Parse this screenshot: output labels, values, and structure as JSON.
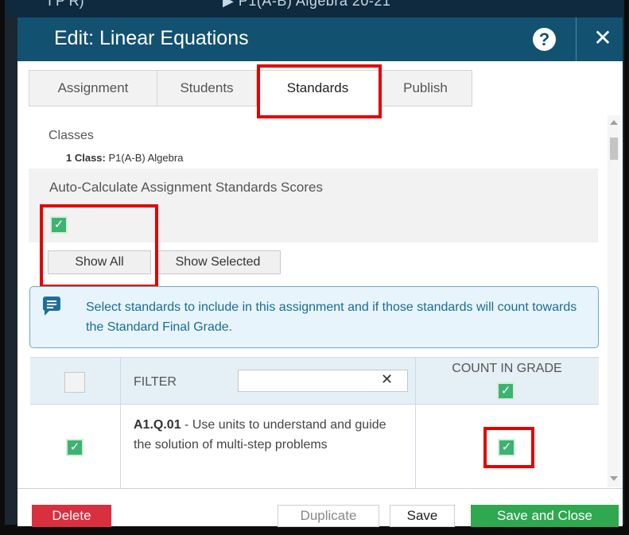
{
  "background": {
    "left_text": "I P R)",
    "center_text": "▶ P1(A-B) Algebra  20-21"
  },
  "header": {
    "title": "Edit: Linear Equations",
    "help_label": "?",
    "close_label": "✕"
  },
  "tabs": [
    {
      "label": "Assignment",
      "active": false
    },
    {
      "label": "Students",
      "active": false
    },
    {
      "label": "Standards",
      "active": true
    },
    {
      "label": "Publish",
      "active": false
    }
  ],
  "classes": {
    "heading": "Classes",
    "count_label": "1 Class:",
    "class_name": "P1(A-B) Algebra"
  },
  "auto_calculate": {
    "label": "Auto-Calculate Assignment Standards Scores",
    "checked": true
  },
  "view_buttons": {
    "show_all": "Show All",
    "show_selected": "Show Selected"
  },
  "info": {
    "message": "Select standards to include in this assignment and if those standards will count towards the Standard Final Grade."
  },
  "table": {
    "filter_label": "FILTER",
    "filter_value": "",
    "filter_clear": "✕",
    "count_in_grade_label": "COUNT IN GRADE",
    "rows": [
      {
        "code": "A1.Q.01",
        "description": " - Use units to understand and guide the solution of multi-step problems",
        "selected": true,
        "count_in_grade": true
      }
    ]
  },
  "footer": {
    "delete": "Delete",
    "duplicate": "Duplicate",
    "save": "Save",
    "save_and_close": "Save and Close"
  },
  "colors": {
    "header_bg": "#135171",
    "checkbox_green": "#3cb371",
    "delete_red": "#d9303f",
    "save_close_green": "#2fa84f",
    "highlight_red": "#e40000",
    "info_text": "#1a6d96"
  }
}
